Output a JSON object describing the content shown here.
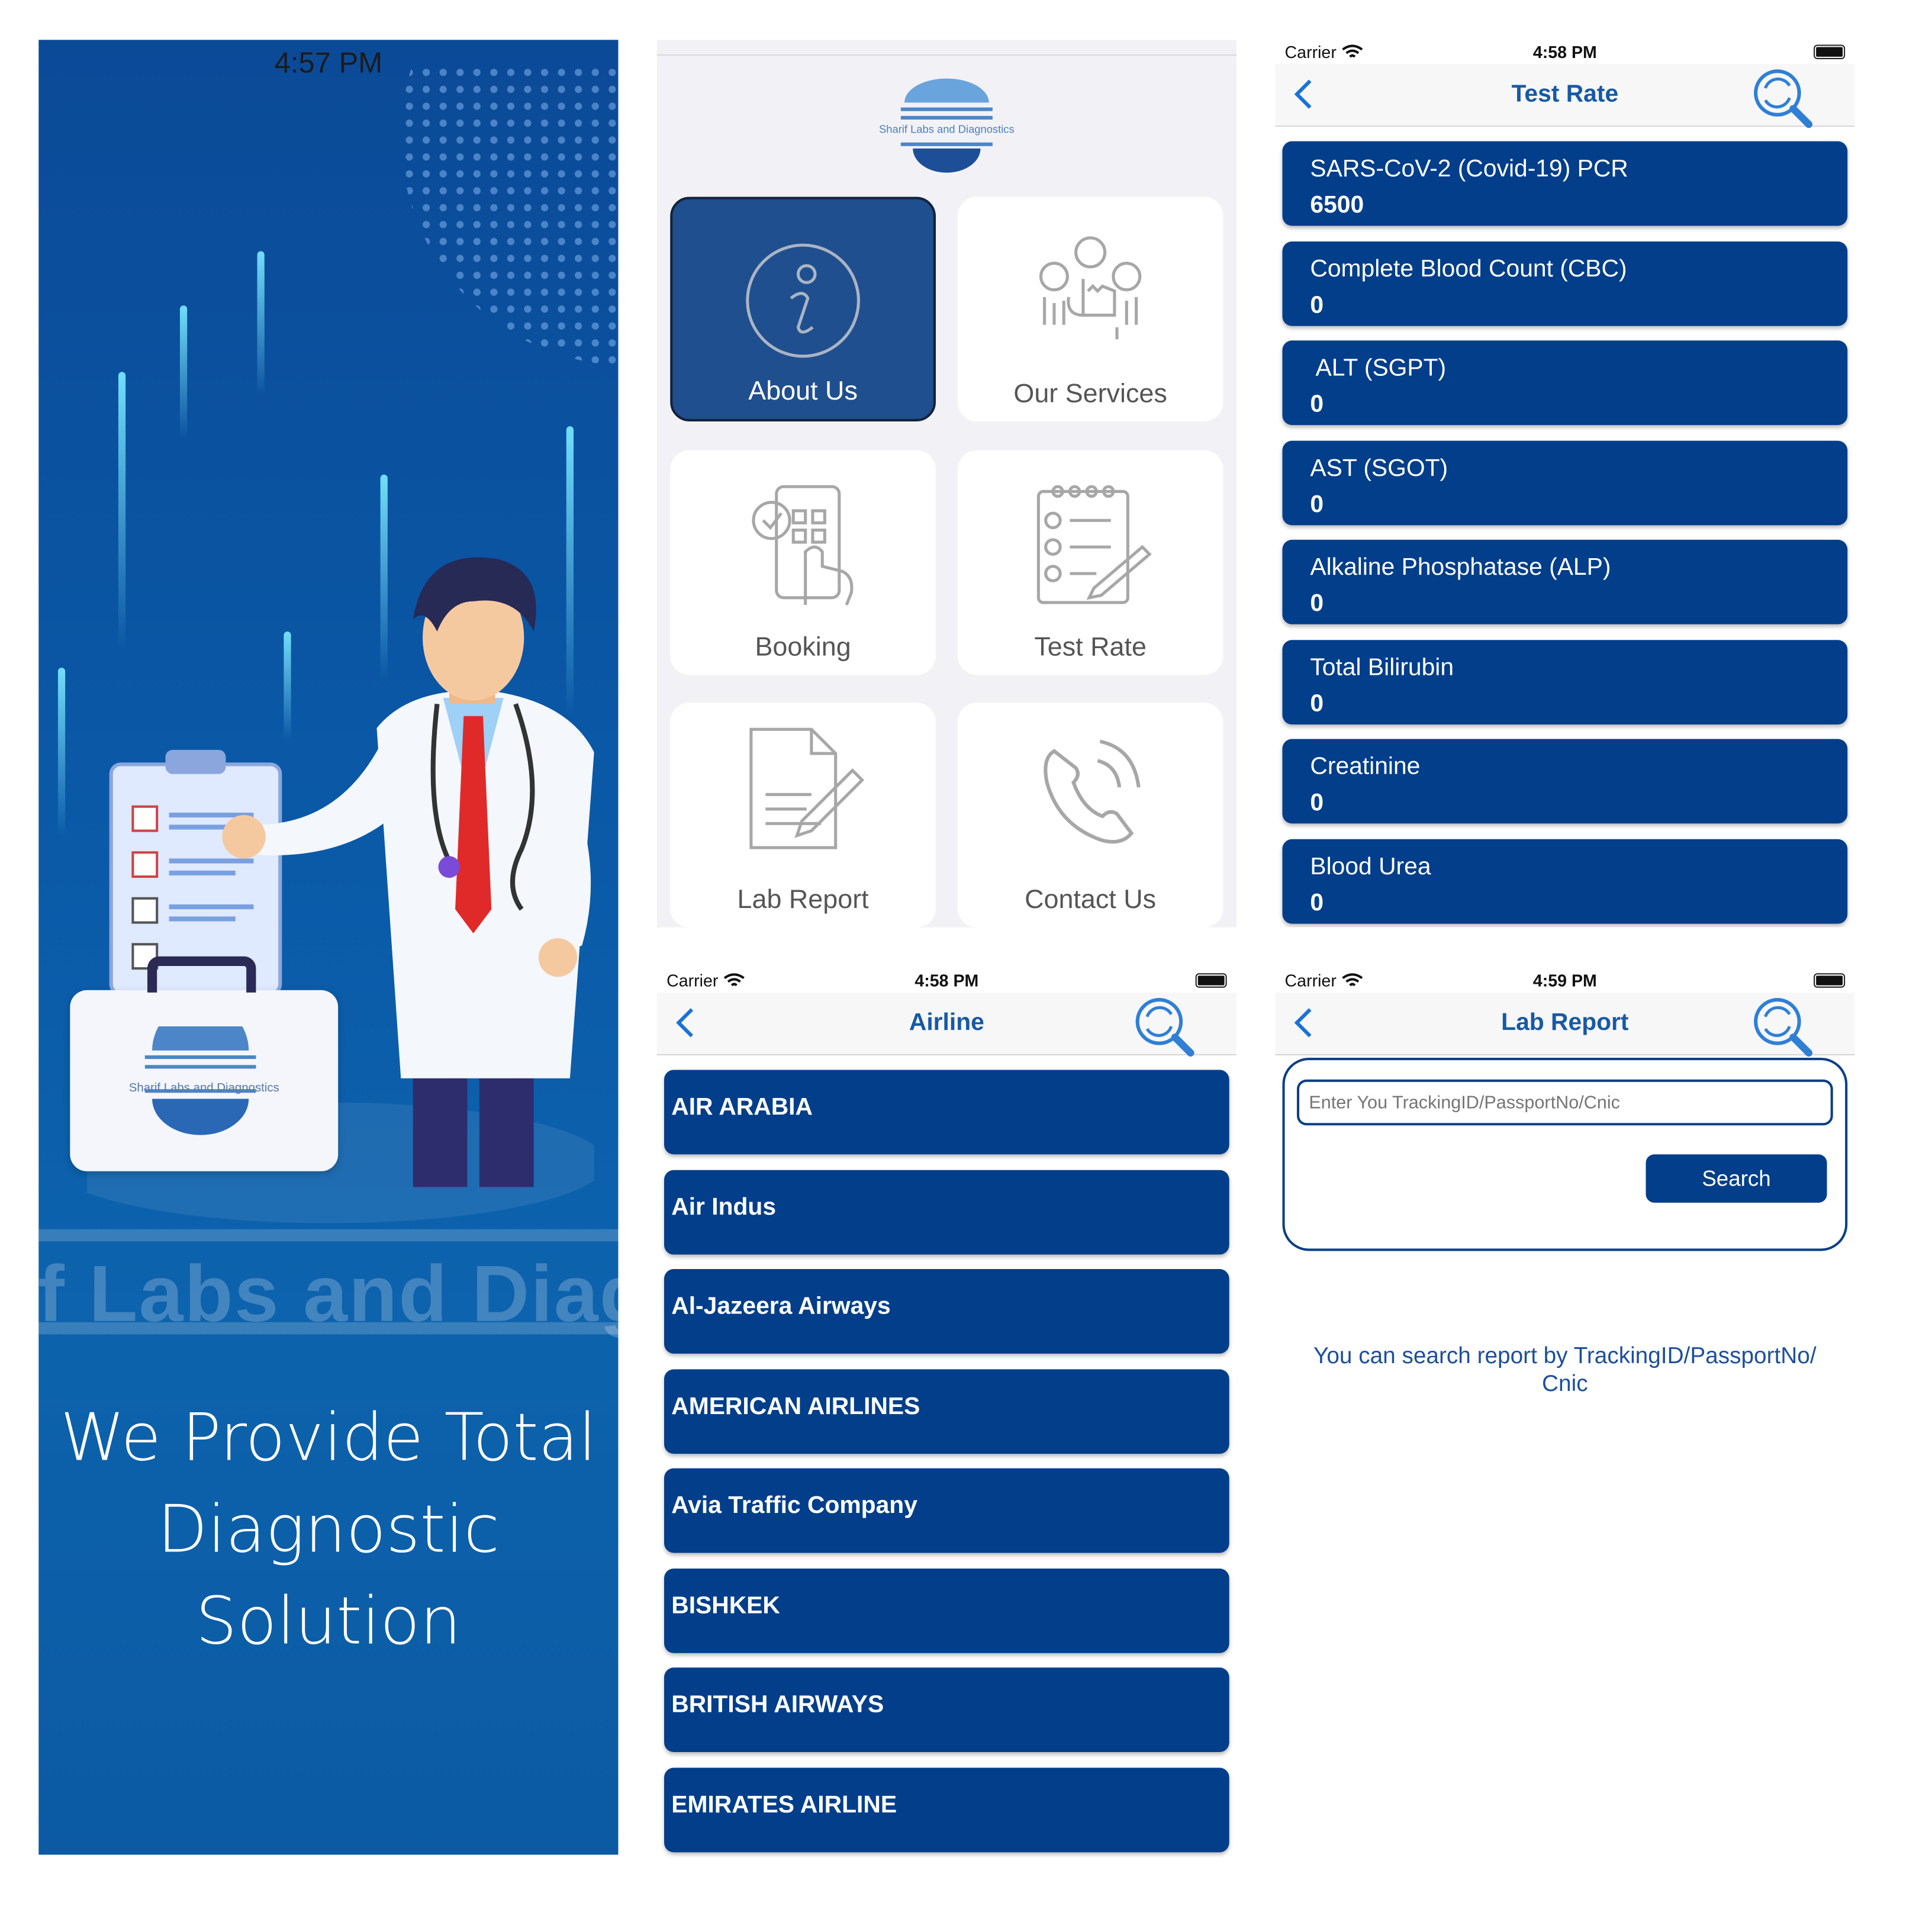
{
  "splash": {
    "time": "4:57 PM",
    "logo_text": "Sharif Labs and Diagnostics",
    "brand_text": "if Labs and Diagnos",
    "tagline_line1": "We Provide Total",
    "tagline_line2": "Diagnostic Solution"
  },
  "home": {
    "logo_text": "Sharif Labs and Diagnostics",
    "tiles": [
      {
        "label": "About Us"
      },
      {
        "label": "Our Services"
      },
      {
        "label": "Booking"
      },
      {
        "label": "Test Rate"
      },
      {
        "label": "Lab Report"
      },
      {
        "label": "Contact Us"
      }
    ]
  },
  "test_rate": {
    "carrier": "Carrier",
    "time": "4:58 PM",
    "title": "Test Rate",
    "items": [
      {
        "name": "SARS-CoV-2 (Covid-19) PCR",
        "price": "6500"
      },
      {
        "name": "Complete Blood Count (CBC)",
        "price": "0"
      },
      {
        "name": " ALT (SGPT)",
        "price": "0"
      },
      {
        "name": "AST (SGOT)",
        "price": "0"
      },
      {
        "name": "Alkaline Phosphatase (ALP)",
        "price": "0"
      },
      {
        "name": "Total Bilirubin",
        "price": "0"
      },
      {
        "name": "Creatinine",
        "price": "0"
      },
      {
        "name": "Blood Urea",
        "price": "0"
      }
    ]
  },
  "airline": {
    "carrier": "Carrier",
    "time": "4:58 PM",
    "title": "Airline",
    "items": [
      "AIR ARABIA",
      "Air Indus",
      "Al-Jazeera Airways",
      "AMERICAN AIRLINES",
      "Avia Traffic Company",
      "BISHKEK",
      "BRITISH AIRWAYS",
      "EMIRATES AIRLINE"
    ]
  },
  "lab_report": {
    "carrier": "Carrier",
    "time": "4:59 PM",
    "title": "Lab Report",
    "placeholder": "Enter You TrackingID/PassportNo/Cnic",
    "button": "Search",
    "hint_line1": "You can search report by TrackingID/PassportNo/",
    "hint_line2": "Cnic"
  },
  "colors": {
    "card_blue": "#023e8a",
    "nav_title_blue": "#1759a6",
    "tile_selected": "#1f4f8f",
    "splash_bg": "#0b5aa3"
  },
  "icons": [
    "info-icon",
    "services-icon",
    "booking-icon",
    "test-rate-icon",
    "lab-report-icon",
    "phone-icon",
    "back-chevron-icon",
    "search-refresh-icon",
    "wifi-icon",
    "battery-icon"
  ]
}
